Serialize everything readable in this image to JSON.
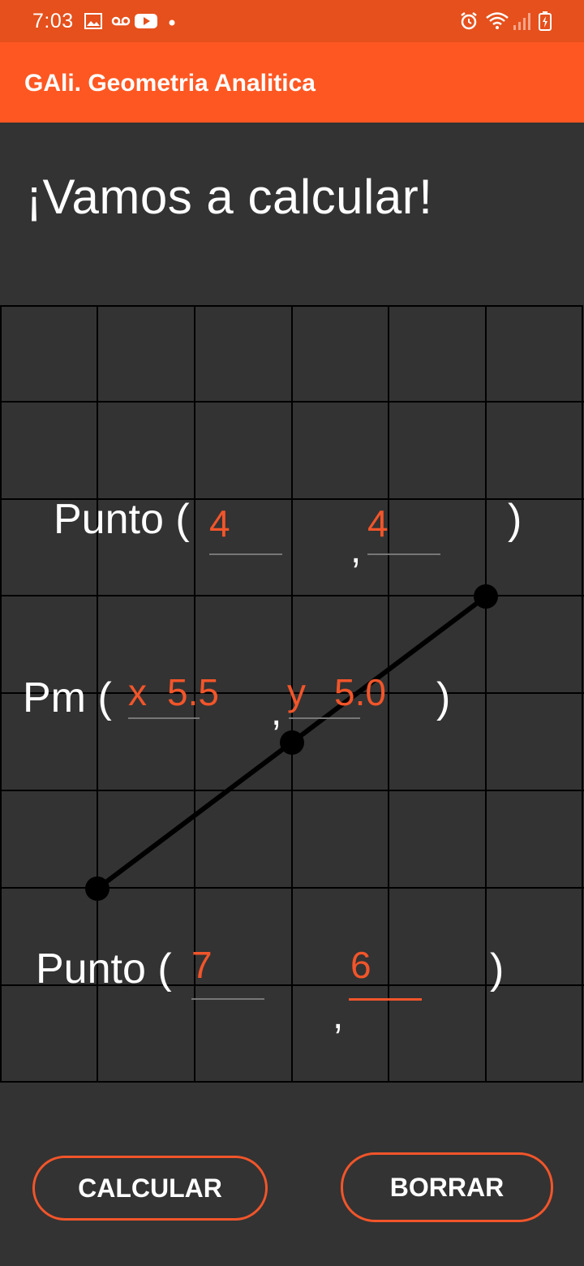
{
  "status_bar": {
    "time": "7:03",
    "icons": [
      "image-icon",
      "voicemail-icon",
      "youtube-icon",
      "dot-icon",
      "alarm-icon",
      "wifi-icon",
      "signal-icon",
      "battery-icon"
    ]
  },
  "app_bar": {
    "title": "GAli. Geometria Analitica"
  },
  "heading": "¡Vamos a calcular!",
  "point1": {
    "label": "Punto (",
    "x": "4",
    "comma": ",",
    "y": "4",
    "close": ")"
  },
  "midpoint": {
    "label": "Pm (",
    "x_prefix": "x",
    "x": "5.5",
    "comma": ",",
    "y_prefix": "y",
    "y": "5.0",
    "close": ")"
  },
  "point2": {
    "label": "Punto (",
    "x": "7",
    "comma": ",",
    "y": "6",
    "close": ")"
  },
  "buttons": {
    "calculate": "CALCULAR",
    "clear": "BORRAR"
  },
  "colors": {
    "status_bar": "#E5501C",
    "app_bar": "#FF5722",
    "accent": "#F2552A",
    "background": "#333333"
  }
}
